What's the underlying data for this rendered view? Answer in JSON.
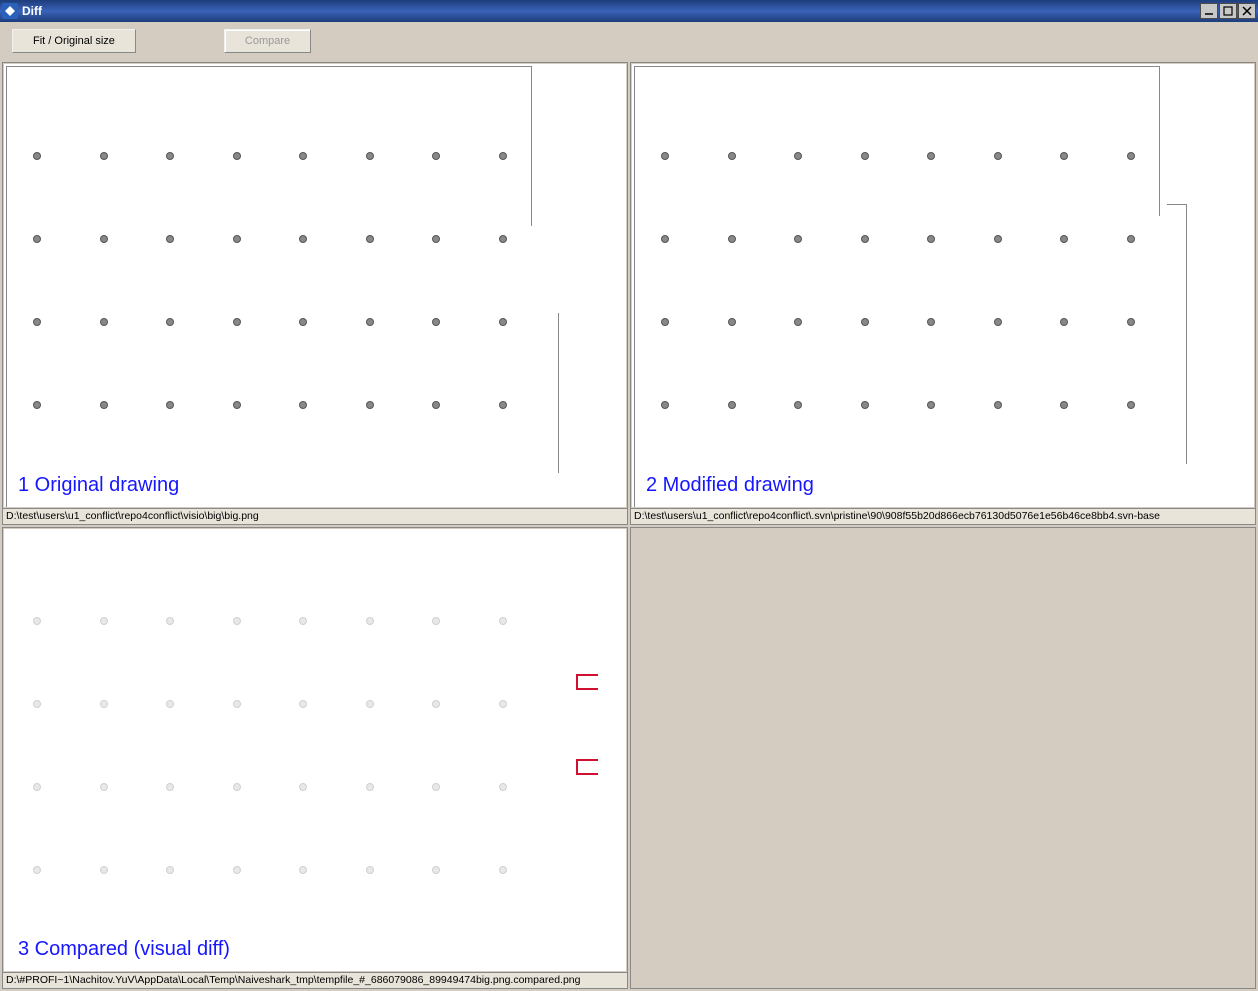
{
  "window": {
    "title": "Diff"
  },
  "toolbar": {
    "fit_button": "Fit / Original size",
    "compare_button": "Compare"
  },
  "panels": {
    "original": {
      "title": "1 Original drawing",
      "path": "D:\\test\\users\\u1_conflict\\repo4conflict\\visio\\big\\big.png"
    },
    "modified": {
      "title": "2 Modified drawing",
      "path": "D:\\test\\users\\u1_conflict\\repo4conflict\\.svn\\pristine\\90\\908f55b20d866ecb76130d5076e1e56b46ce8bb4.svn-base"
    },
    "compared": {
      "title": "3 Compared (visual diff)",
      "path": "D:\\#PROFI~1\\Nachitov.YuV\\AppData\\Local\\Temp\\Naiveshark_tmp\\tempfile_#_686079086_89949474big.png.compared.png"
    }
  }
}
